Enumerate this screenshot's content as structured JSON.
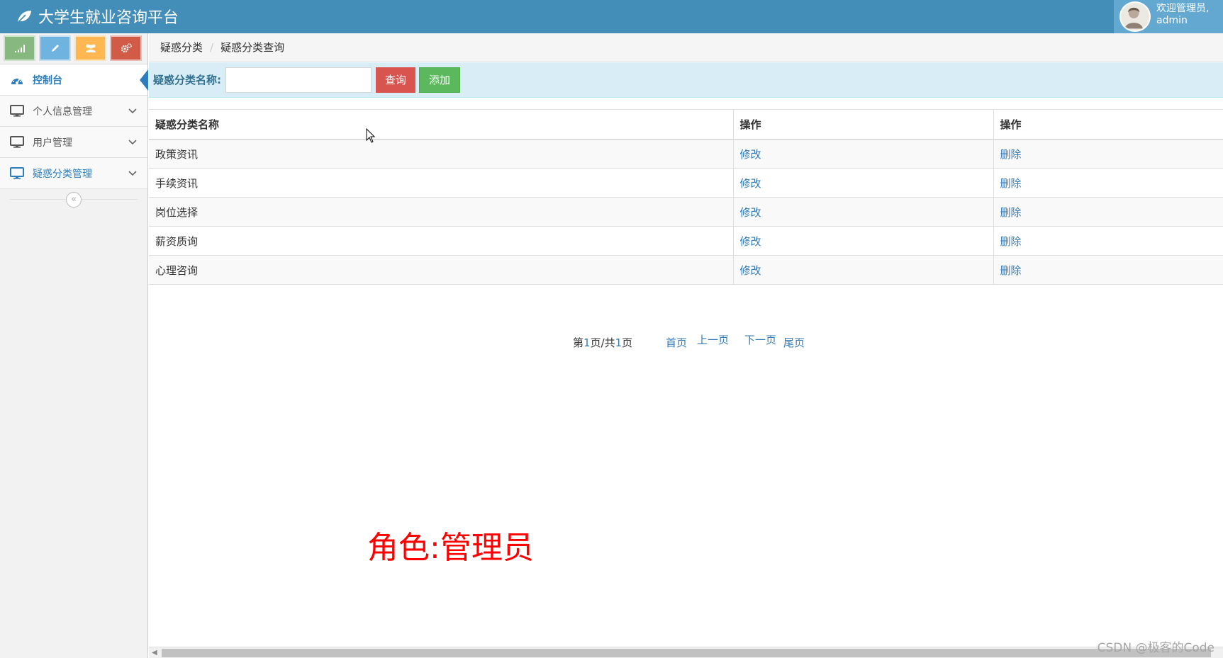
{
  "app": {
    "title": "大学生就业咨询平台"
  },
  "user": {
    "welcome": "欢迎管理员,",
    "name": "admin"
  },
  "shortcuts": [
    {
      "icon": "signal-icon",
      "color": "#87b87f"
    },
    {
      "icon": "pencil-icon",
      "color": "#6fb3e0"
    },
    {
      "icon": "users-icon",
      "color": "#ffb752"
    },
    {
      "icon": "cogs-icon",
      "color": "#d15b47"
    }
  ],
  "sidebar": {
    "items": [
      {
        "label": "控制台",
        "icon": "dashboard-icon",
        "active": true
      },
      {
        "label": "个人信息管理",
        "icon": "desktop-icon"
      },
      {
        "label": "用户管理",
        "icon": "desktop-icon"
      },
      {
        "label": "疑惑分类管理",
        "icon": "desktop-icon",
        "highlight": true
      }
    ]
  },
  "breadcrumb": {
    "first": "疑惑分类",
    "second": "疑惑分类查询"
  },
  "search": {
    "label": "疑惑分类名称:",
    "value": "",
    "query_button": "查询",
    "add_button": "添加"
  },
  "table": {
    "headers": [
      "疑惑分类名称",
      "操作",
      "操作"
    ],
    "rows": [
      {
        "name": "政策资讯",
        "edit": "修改",
        "delete": "删除"
      },
      {
        "name": "手续资讯",
        "edit": "修改",
        "delete": "删除"
      },
      {
        "name": "岗位选择",
        "edit": "修改",
        "delete": "删除"
      },
      {
        "name": "薪资质询",
        "edit": "修改",
        "delete": "删除"
      },
      {
        "name": "心理咨询",
        "edit": "修改",
        "delete": "删除"
      }
    ]
  },
  "pagination": {
    "prefix": "第",
    "current": "1",
    "middle": "页/共",
    "total": "1",
    "suffix": "页",
    "first": "首页",
    "prev": "上一页",
    "next": "下一页",
    "last": "尾页"
  },
  "annotation": {
    "role": "角色:管理员"
  },
  "watermark": "CSDN @极客的Code",
  "colors": {
    "header": "#438eb9",
    "user_box": "#62a8d1",
    "link": "#337ab7",
    "search_bg": "#d9edf7",
    "danger": "#d9534f",
    "success": "#5cb85c"
  }
}
